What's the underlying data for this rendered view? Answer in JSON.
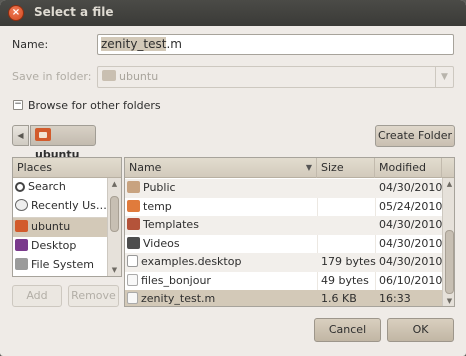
{
  "window": {
    "title": "Select a file",
    "close_glyph": "×"
  },
  "form": {
    "name_label": "Name:",
    "name_value_selected": "zenity_test",
    "name_value_rest": ".m",
    "save_in_label": "Save in folder:",
    "save_in_value": "ubuntu"
  },
  "browse": {
    "expander_glyph": "−",
    "label": "Browse for other folders"
  },
  "pathbar": {
    "back_glyph": "◀",
    "current": "ubuntu",
    "create_folder": "Create Folder"
  },
  "places": {
    "header": "Places",
    "items": [
      {
        "label": "Search",
        "icon": "search-icon"
      },
      {
        "label": "Recently Us…",
        "icon": "recent-icon"
      },
      {
        "label": "ubuntu",
        "icon": "home-folder-icon",
        "selected": true
      },
      {
        "label": "Desktop",
        "icon": "desktop-icon"
      },
      {
        "label": "File System",
        "icon": "filesystem-icon"
      }
    ],
    "add": "Add",
    "remove": "Remove"
  },
  "files": {
    "columns": {
      "name": "Name",
      "size": "Size",
      "modified": "Modified"
    },
    "sort_glyph": "▼",
    "rows": [
      {
        "name": "Public",
        "size": "",
        "modified": "04/30/2010",
        "icon": "public-folder-icon"
      },
      {
        "name": "temp",
        "size": "",
        "modified": "05/24/2010",
        "icon": "folder-icon"
      },
      {
        "name": "Templates",
        "size": "",
        "modified": "04/30/2010",
        "icon": "templates-folder-icon"
      },
      {
        "name": "Videos",
        "size": "",
        "modified": "04/30/2010",
        "icon": "videos-folder-icon"
      },
      {
        "name": "examples.desktop",
        "size": "179 bytes",
        "modified": "04/30/2010",
        "icon": "desktop-file-icon"
      },
      {
        "name": "files_bonjour",
        "size": "49 bytes",
        "modified": "06/10/2010",
        "icon": "text-file-icon"
      },
      {
        "name": "zenity_test.m",
        "size": "1.6 KB",
        "modified": "16:33",
        "icon": "text-file-icon",
        "selected": true
      }
    ]
  },
  "buttons": {
    "cancel": "Cancel",
    "ok": "OK"
  }
}
